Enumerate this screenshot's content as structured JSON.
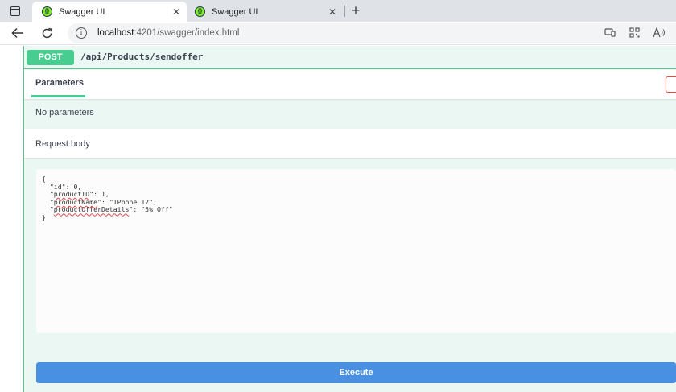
{
  "tabs": [
    {
      "title": "Swagger UI",
      "active": true
    },
    {
      "title": "Swagger UI",
      "active": false
    }
  ],
  "toolbar": {
    "url_host": "localhost",
    "url_rest": ":4201/swagger/index.html"
  },
  "operation": {
    "method": "POST",
    "path": "/api/Products/sendoffer",
    "method_color": "#49cc90"
  },
  "parameters": {
    "tab_label": "Parameters",
    "empty_text": "No parameters"
  },
  "request_body": {
    "title": "Request body",
    "lines": [
      {
        "prefix": "{",
        "key": "",
        "suffix": ""
      },
      {
        "prefix": "  \"",
        "key": "id",
        "suffix": "\": 0,"
      },
      {
        "prefix": "  \"",
        "key": "productID",
        "suffix": "\": 1,"
      },
      {
        "prefix": "  \"",
        "key": "productName",
        "suffix": "\": \"IPhone 12\","
      },
      {
        "prefix": "  \"",
        "key": "productOfferDetails",
        "suffix": "\": \"5% Off\""
      },
      {
        "prefix": "}",
        "key": "",
        "suffix": ""
      }
    ]
  },
  "execute_label": "Execute",
  "colors": {
    "execute": "#4990e2",
    "opblock_bg": "#ebf7f2"
  }
}
